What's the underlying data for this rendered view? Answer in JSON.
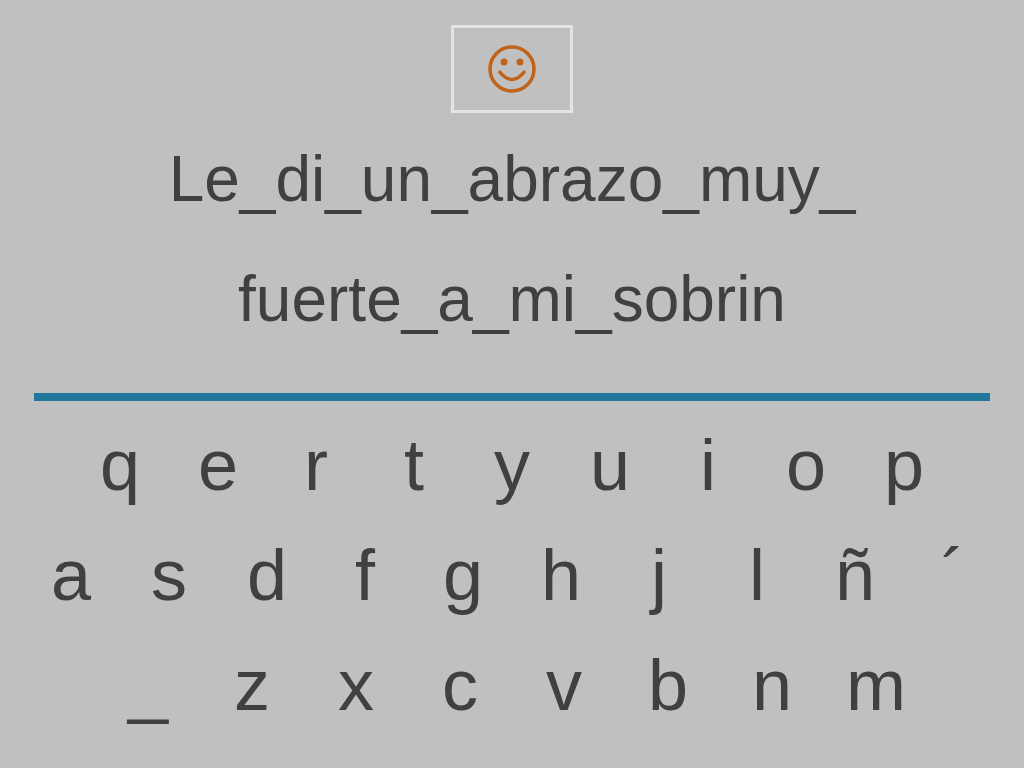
{
  "sentence_lines": [
    "Le_di_un_abrazo_muy_",
    "fuerte_a_mi_sobrin"
  ],
  "keyboard_rows": [
    [
      "q",
      "e",
      "r",
      "t",
      "y",
      "u",
      "i",
      "o",
      "p"
    ],
    [
      "a",
      "s",
      "d",
      "f",
      "g",
      "h",
      "j",
      "l",
      "ñ",
      "´"
    ],
    [
      "_",
      "z",
      "x",
      "c",
      "v",
      "b",
      "n",
      "m"
    ]
  ]
}
